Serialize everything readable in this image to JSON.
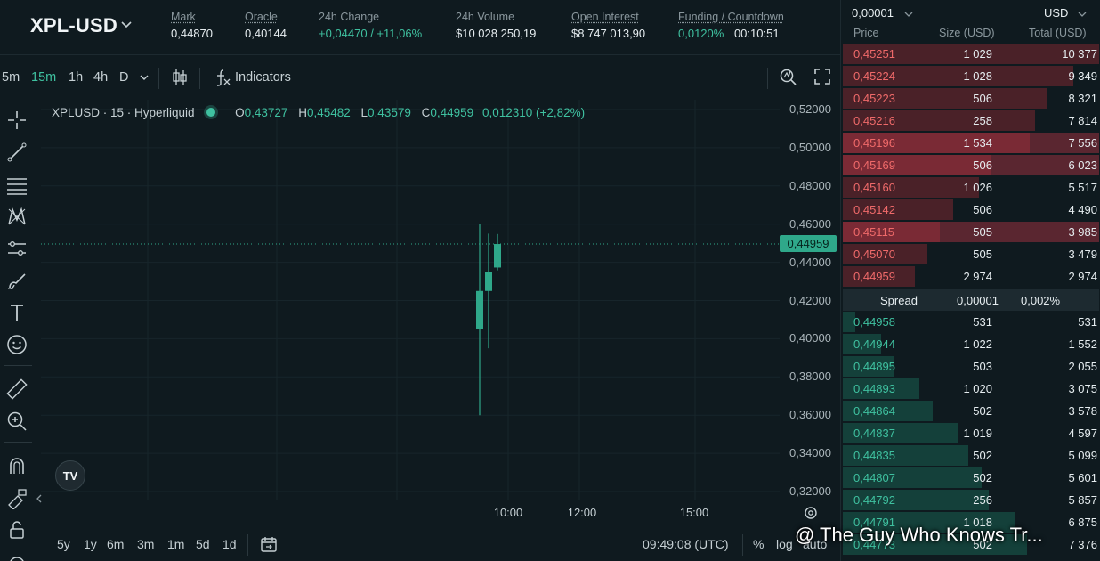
{
  "header": {
    "pair": "XPL-USD",
    "stats": [
      {
        "label": "Mark",
        "value": "0,44870",
        "underline": true
      },
      {
        "label": "Oracle",
        "value": "0,40144",
        "underline": true
      },
      {
        "label": "24h Change",
        "value": "+0,04470 / +11,06%",
        "underline": false
      },
      {
        "label": "24h Volume",
        "value": "$10 028 250,19",
        "underline": false
      },
      {
        "label": "Open Interest",
        "value": "$8 747 013,90",
        "underline": true
      },
      {
        "label": "Funding / Countdown",
        "value_rate": "0,0120%",
        "value_time": "00:10:51",
        "underline": true
      }
    ]
  },
  "toolbar": {
    "timeframes": [
      "5m",
      "15m",
      "1h",
      "4h",
      "D"
    ],
    "active_timeframe": "15m",
    "indicators_label": "Indicators",
    "indicators_icon": "fx-icon"
  },
  "legend": {
    "symbol": "XPLUSD · 15 · Hyperliquid",
    "o_key": "O",
    "o": "0,43727",
    "h_key": "H",
    "h": "0,45482",
    "l_key": "L",
    "l": "0,43579",
    "c_key": "C",
    "c": "0,44959",
    "change": "0,012310 (+2,82%)"
  },
  "chart_data": {
    "type": "candlestick",
    "y_ticks": [
      "0,52000",
      "0,50000",
      "0,48000",
      "0,46000",
      "0,44000",
      "0,42000",
      "0,40000",
      "0,38000",
      "0,36000",
      "0,34000",
      "0,32000"
    ],
    "ylim": [
      0.32,
      0.52
    ],
    "x_ticks": [
      "10:00",
      "12:00",
      "15:00"
    ],
    "last_price": 0.44959,
    "last_price_label": "0,44959",
    "candles": [
      {
        "o": 0.405,
        "h": 0.46,
        "l": 0.36,
        "c": 0.425
      },
      {
        "o": 0.425,
        "h": 0.455,
        "l": 0.395,
        "c": 0.435
      },
      {
        "o": 0.43727,
        "h": 0.45482,
        "l": 0.43579,
        "c": 0.44959
      }
    ],
    "up_color": "#2fa88a",
    "down_color": "#f06a6a"
  },
  "bottombar": {
    "ranges": [
      "5y",
      "1y",
      "6m",
      "3m",
      "1m",
      "5d",
      "1d"
    ],
    "clock": "09:49:08 (UTC)",
    "percent": "%",
    "log": "log",
    "auto": "auto"
  },
  "orderbook": {
    "tick": "0,00001",
    "currency": "USD",
    "headers": {
      "price": "Price",
      "size": "Size (USD)",
      "total": "Total (USD)"
    },
    "asks": [
      {
        "price": "0,45251",
        "size": "1 029",
        "total": "10 377",
        "depth": 1.0
      },
      {
        "price": "0,45224",
        "size": "1 028",
        "total": "9 349",
        "depth": 0.9
      },
      {
        "price": "0,45223",
        "size": "506",
        "total": "8 321",
        "depth": 0.8
      },
      {
        "price": "0,45216",
        "size": "258",
        "total": "7 814",
        "depth": 0.75
      },
      {
        "price": "0,45196",
        "size": "1 534",
        "total": "7 556",
        "depth": 0.73,
        "hl": true
      },
      {
        "price": "0,45169",
        "size": "506",
        "total": "6 023",
        "depth": 0.58,
        "hl": true
      },
      {
        "price": "0,45160",
        "size": "1 026",
        "total": "5 517",
        "depth": 0.53
      },
      {
        "price": "0,45142",
        "size": "506",
        "total": "4 490",
        "depth": 0.43
      },
      {
        "price": "0,45115",
        "size": "505",
        "total": "3 985",
        "depth": 0.38,
        "hl": true
      },
      {
        "price": "0,45070",
        "size": "505",
        "total": "3 479",
        "depth": 0.33
      },
      {
        "price": "0,44959",
        "size": "2 974",
        "total": "2 974",
        "depth": 0.28
      }
    ],
    "spread": {
      "label": "Spread",
      "value": "0,00001",
      "percent": "0,002%"
    },
    "bids": [
      {
        "price": "0,44958",
        "size": "531",
        "total": "531",
        "depth": 0.05
      },
      {
        "price": "0,44944",
        "size": "1 022",
        "total": "1 552",
        "depth": 0.15
      },
      {
        "price": "0,44895",
        "size": "503",
        "total": "2 055",
        "depth": 0.2
      },
      {
        "price": "0,44893",
        "size": "1 020",
        "total": "3 075",
        "depth": 0.3
      },
      {
        "price": "0,44864",
        "size": "502",
        "total": "3 578",
        "depth": 0.35
      },
      {
        "price": "0,44837",
        "size": "1 019",
        "total": "4 597",
        "depth": 0.45
      },
      {
        "price": "0,44835",
        "size": "502",
        "total": "5 099",
        "depth": 0.49
      },
      {
        "price": "0,44807",
        "size": "502",
        "total": "5 601",
        "depth": 0.54
      },
      {
        "price": "0,44792",
        "size": "256",
        "total": "5 857",
        "depth": 0.57
      },
      {
        "price": "0,44791",
        "size": "1 018",
        "total": "6 875",
        "depth": 0.67
      },
      {
        "price": "0,44773",
        "size": "502",
        "total": "7 376",
        "depth": 0.72
      }
    ]
  },
  "watermark": "@ The Guy Who Knows Tr...",
  "colors": {
    "bg": "#0f1a1f",
    "green": "#3fc1a0",
    "red": "#f06a6a"
  }
}
